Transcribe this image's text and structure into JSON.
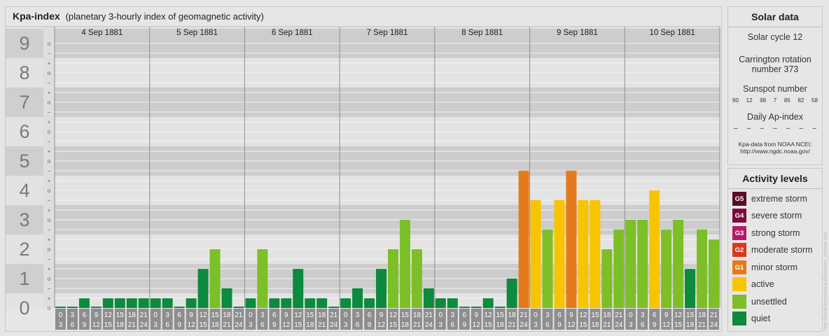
{
  "header": {
    "title": "Kpa-index",
    "subtitle": "(planetary 3-hourly index of geomagnetic activity)"
  },
  "chart_data": {
    "type": "bar",
    "title": "Kpa-index",
    "subtitle": "(planetary 3-hourly index of geomagnetic activity)",
    "ylim": [
      0,
      9
    ],
    "y_ticks": [
      "0",
      "1",
      "2",
      "3",
      "4",
      "5",
      "6",
      "7",
      "8",
      "9"
    ],
    "y_minor_labels": [
      "o",
      "+",
      "−"
    ],
    "days": [
      "4 Sep 1881",
      "5 Sep 1881",
      "6 Sep 1881",
      "7 Sep 1881",
      "8 Sep 1881",
      "9 Sep 1881",
      "10 Sep 1881"
    ],
    "interval_start": [
      "0",
      "3",
      "6",
      "9",
      "12",
      "15",
      "18",
      "21"
    ],
    "interval_end": [
      "3",
      "6",
      "9",
      "12",
      "15",
      "18",
      "21",
      "24"
    ],
    "values": [
      [
        0,
        0,
        0.33,
        0,
        0.33,
        0.33,
        0.33,
        0.33
      ],
      [
        0.33,
        0.33,
        0,
        0.33,
        1.33,
        2,
        0.67,
        0
      ],
      [
        0.33,
        2,
        0.33,
        0.33,
        1.33,
        0.33,
        0.33,
        0
      ],
      [
        0.33,
        0.67,
        0.33,
        1.33,
        2,
        3,
        2,
        0.67
      ],
      [
        0.33,
        0.33,
        0,
        0,
        0.33,
        0,
        1,
        4.67
      ],
      [
        3.67,
        2.67,
        3.67,
        4.67,
        3.67,
        3.67,
        2,
        2.67
      ],
      [
        3,
        3,
        4,
        2.67,
        3,
        1.33,
        2.67,
        2.33
      ]
    ],
    "color_scale": [
      {
        "min": 0,
        "max": 1.5,
        "color": "#0c8a3d",
        "label": "quiet"
      },
      {
        "min": 1.5,
        "max": 3.5,
        "color": "#7cbf26",
        "label": "unsettled"
      },
      {
        "min": 3.5,
        "max": 4.5,
        "color": "#f8c400",
        "label": "active"
      },
      {
        "min": 4.5,
        "max": 5.5,
        "color": "#e57a1c",
        "label": "minor storm"
      }
    ]
  },
  "solar": {
    "title": "Solar data",
    "solar_cycle": "Solar cycle 12",
    "carrington_line1": "Carrington rotation",
    "carrington_line2": "number 373",
    "sunspot_label": "Sunspot number",
    "sunspot_numbers": [
      "90",
      "12",
      "98",
      "7",
      "85",
      "82",
      "58"
    ],
    "ap_label": "Daily Ap-index",
    "ap_values": [
      "–",
      "–",
      "–",
      "–",
      "–",
      "–",
      "–"
    ],
    "source_line1": "Kpa-data from NOAA NCEI:",
    "source_line2": "http://www.ngdc.noaa.gov/"
  },
  "activity": {
    "title": "Activity levels",
    "levels": [
      {
        "badge": "G5",
        "label": "extreme storm",
        "color": "#5a0b2a"
      },
      {
        "badge": "G4",
        "label": "severe storm",
        "color": "#7c0c3c"
      },
      {
        "badge": "G3",
        "label": "strong storm",
        "color": "#b8186a"
      },
      {
        "badge": "G2",
        "label": "moderate storm",
        "color": "#d6391c"
      },
      {
        "badge": "G1",
        "label": "minor storm",
        "color": "#e57a1c"
      },
      {
        "badge": "",
        "label": "active",
        "color": "#f8c400"
      },
      {
        "badge": "",
        "label": "unsettled",
        "color": "#7cbf26"
      },
      {
        "badge": "",
        "label": "quiet",
        "color": "#0c8a3d"
      }
    ]
  },
  "credit": "http://www.theuseful.eu/lamanko_archive.php"
}
